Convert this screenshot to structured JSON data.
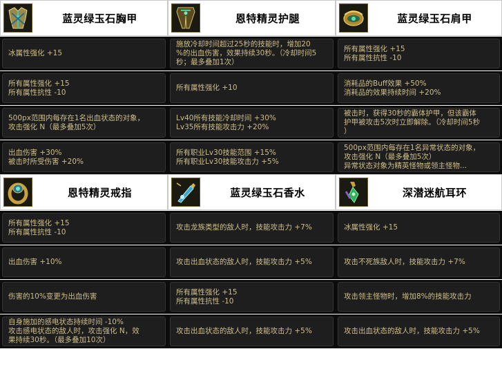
{
  "sections": [
    [
      {
        "title": "蓝灵绿玉石胸甲",
        "icon": "chest-armor-icon",
        "rows": [
          [
            "冰属性强化 +15"
          ],
          [
            "所有属性强化 +15",
            "所有属性抗性 -10"
          ],
          [
            "500px范围内每存在1名出血状态的对象，",
            "攻击强化 N（最多叠加5次）"
          ],
          [
            "出血伤害 +30%",
            "被击时所受伤害 +20%"
          ]
        ]
      },
      {
        "title": "恩特精灵戒指",
        "icon": "ring-icon",
        "rows": [
          [
            "所有属性强化 +15",
            "所有属性抗性 -10"
          ],
          [
            "出血伤害 +10%"
          ],
          [
            "伤害的10%变更为出血伤害"
          ],
          [
            "自身施加的感电状态持续时间 -10%",
            "攻击感电状态的敌人时，攻击强化 N，效",
            "果持续30秒。（最多叠加10次）"
          ]
        ]
      }
    ],
    [
      {
        "title": "恩特精灵护腿",
        "icon": "leg-armor-icon",
        "rows": [
          [
            "施放冷却时间超过25秒的技能时，增加20",
            "%的出血伤害，效果持续30秒。（冷却时间5",
            "秒；最多叠加1次）"
          ],
          [
            "所有属性强化 +10"
          ],
          [
            "Lv40所有技能冷却时间 +30%",
            "Lv35所有技能攻击力 +20%"
          ],
          [
            "所有职业Lv30技能范围 +15%",
            "所有职业Lv30技能攻击力 +5%"
          ]
        ]
      },
      {
        "title": "蓝灵绿玉石香水",
        "icon": "perfume-bottle-icon",
        "rows": [
          [
            "攻击龙族类型的敌人时，技能攻击力 +7%"
          ],
          [
            "攻击出血状态的敌人时，技能攻击力 +5%"
          ],
          [
            "所有属性强化 +15",
            "所有属性抗性 -10"
          ],
          [
            "攻击出血状态的敌人时，技能攻击力 +5%"
          ]
        ]
      }
    ],
    [
      {
        "title": "蓝灵绿玉石肩甲",
        "icon": "shoulder-armor-icon",
        "rows": [
          [
            "所有属性强化 +15",
            "所有属性抗性 -10"
          ],
          [
            "消耗品的Buff效果 +50%",
            "消耗品的效果持续时间 +20%"
          ],
          [
            "被击时，获得30秒的霸体护甲，但该霸体",
            "护甲被攻击5次时立即解除。（冷却时间5秒",
            "）"
          ],
          [
            "500px范围内每存在1名异常状态的对象，",
            "攻击强化 N（最多叠加5次）",
            "异常状态对象为精英怪物或领主怪物..."
          ]
        ]
      },
      {
        "title": "深潜迷航耳环",
        "icon": "earring-icon",
        "rows": [
          [
            "冰属性强化 +15"
          ],
          [
            "攻击不死族敌人时，技能攻击力 +7%"
          ],
          [
            "攻击领主怪物时，增加8%的技能攻击力"
          ],
          [
            "攻击出血状态的敌人时，技能攻击力 +5%"
          ]
        ]
      }
    ]
  ]
}
